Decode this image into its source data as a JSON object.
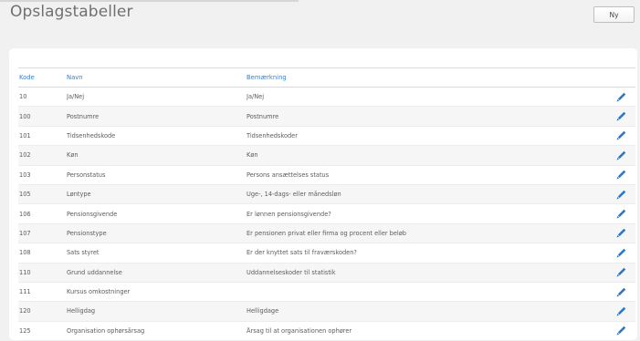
{
  "page": {
    "title": "Opslagstabeller",
    "new_button_label": "Ny"
  },
  "table": {
    "headers": {
      "kode": "Kode",
      "navn": "Navn",
      "bemaerkning": "Bemærkning"
    },
    "rows": [
      {
        "kode": "10",
        "navn": "Ja/Nej",
        "bemaerkning": "Ja/Nej"
      },
      {
        "kode": "100",
        "navn": "Postnumre",
        "bemaerkning": "Postnumre"
      },
      {
        "kode": "101",
        "navn": "Tidsenhedskode",
        "bemaerkning": "Tidsenhedskoder"
      },
      {
        "kode": "102",
        "navn": "Køn",
        "bemaerkning": "Køn"
      },
      {
        "kode": "103",
        "navn": "Personstatus",
        "bemaerkning": "Persons ansættelses status"
      },
      {
        "kode": "105",
        "navn": "Løntype",
        "bemaerkning": "Uge-, 14-dags- eller månedsløn"
      },
      {
        "kode": "106",
        "navn": "Pensionsgivende",
        "bemaerkning": "Er lønnen pensionsgivende?"
      },
      {
        "kode": "107",
        "navn": "Pensionstype",
        "bemaerkning": "Er pensionen privat eller firma og procent eller beløb"
      },
      {
        "kode": "108",
        "navn": "Sats styret",
        "bemaerkning": "Er der knyttet sats til fraværskoden?"
      },
      {
        "kode": "110",
        "navn": "Grund uddannelse",
        "bemaerkning": "Uddannelseskoder til statistik"
      },
      {
        "kode": "111",
        "navn": "Kursus omkostninger",
        "bemaerkning": ""
      },
      {
        "kode": "120",
        "navn": "Helligdag",
        "bemaerkning": "Helligdage"
      },
      {
        "kode": "125",
        "navn": "Organisation ophørsårsag",
        "bemaerkning": "Årsag til at organisationen ophører"
      }
    ],
    "edit_icon": "pencil-icon",
    "accent_color": "#2f77c0"
  }
}
